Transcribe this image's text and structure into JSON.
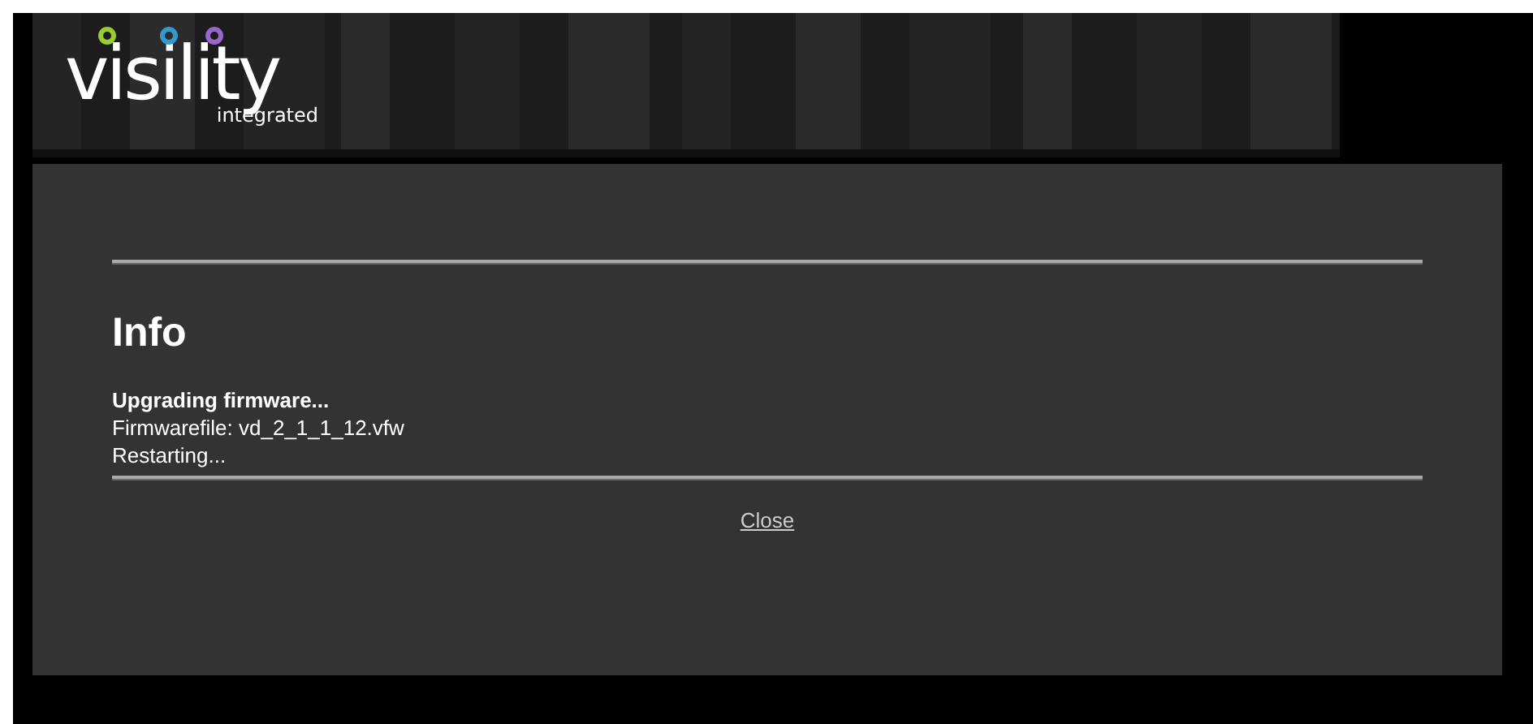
{
  "header": {
    "logo": {
      "name": "visility",
      "tagline": "integrated"
    }
  },
  "dialog": {
    "title": "Info",
    "lines": [
      {
        "text": "Upgrading firmware...",
        "bold": true
      },
      {
        "text": "Firmwarefile: vd_2_1_1_12.vfw",
        "bold": false
      },
      {
        "text": "Restarting...",
        "bold": false
      }
    ],
    "link": "Close"
  }
}
